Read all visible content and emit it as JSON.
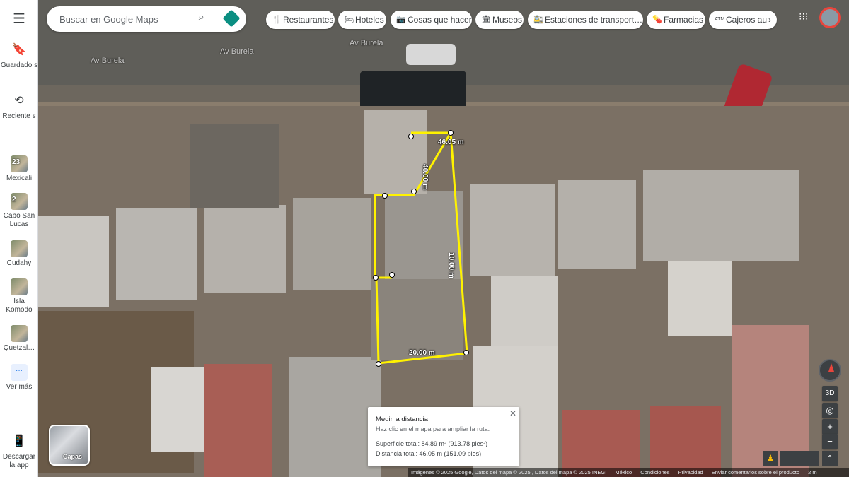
{
  "rail": {
    "menu_icon": "hamburger-icon",
    "items": [
      {
        "label": "Guardado s",
        "icon": "bookmark-icon"
      },
      {
        "label": "Reciente s",
        "icon": "history-icon"
      },
      {
        "label": "Mexicali",
        "badge": "23"
      },
      {
        "label": "Cabo San Lucas",
        "badge": "2"
      },
      {
        "label": "Cudahy"
      },
      {
        "label": "Isla Komodo"
      },
      {
        "label": "Quetzal…"
      },
      {
        "label": "Ver más",
        "icon": "dots-icon"
      },
      {
        "label": "Descargar la app",
        "icon": "phone-icon"
      }
    ]
  },
  "search": {
    "placeholder": "Buscar en Google Maps"
  },
  "chips": [
    {
      "label": "Restaurantes",
      "icon": "🍴"
    },
    {
      "label": "Hoteles",
      "icon": "🛏"
    },
    {
      "label": "Cosas que hacer",
      "icon": "📷"
    },
    {
      "label": "Museos",
      "icon": "🏛"
    },
    {
      "label": "Estaciones de transport…",
      "icon": "🚉"
    },
    {
      "label": "Farmacias",
      "icon": "💊"
    },
    {
      "label": "Cajeros au",
      "icon": "ATM"
    }
  ],
  "streets": [
    "Av Burela",
    "Av Burela",
    "Av Burela"
  ],
  "measurements": {
    "seg1": "46.05 m",
    "seg2": "40.00 m",
    "seg3": "10.00 m",
    "seg4": "20.00 m"
  },
  "info": {
    "title": "Medir la distancia",
    "subtitle": "Haz clic en el mapa para ampliar la ruta.",
    "area": "Superficie total: 84.89 m² (913.78 pies²)",
    "distance": "Distancia total: 46.05 m (151.09 pies)"
  },
  "layers_label": "Capas",
  "controls": {
    "three_d": "3D"
  },
  "footer": [
    "Imágenes © 2025 Google, Datos del mapa © 2025 , Datos del mapa © 2025 INEGI",
    "México",
    "Condiciones",
    "Privacidad",
    "Enviar comentarios sobre el producto",
    "2 m"
  ]
}
